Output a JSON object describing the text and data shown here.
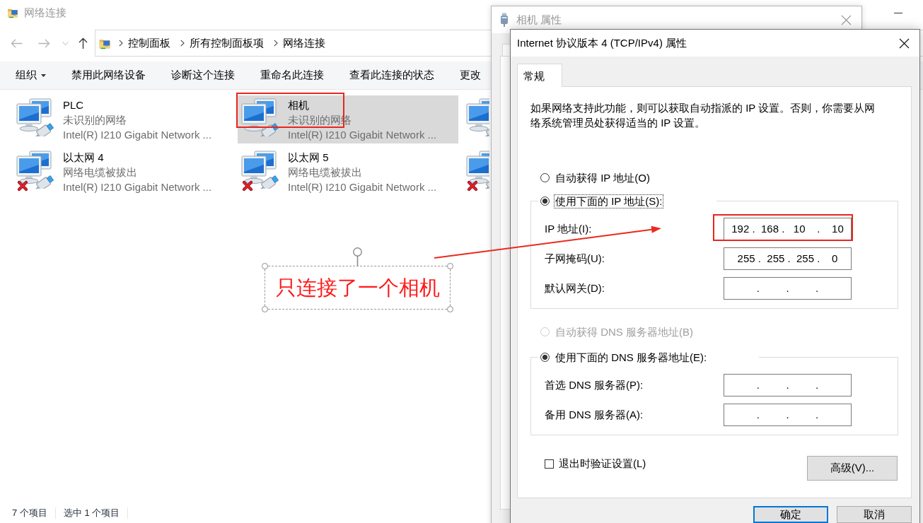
{
  "explorer": {
    "title": "网络连接",
    "breadcrumb": [
      "控制面板",
      "所有控制面板项",
      "网络连接"
    ],
    "commands": [
      {
        "label": "组织",
        "menu": true
      },
      {
        "label": "禁用此网络设备",
        "menu": false
      },
      {
        "label": "诊断这个连接",
        "menu": false
      },
      {
        "label": "重命名此连接",
        "menu": false
      },
      {
        "label": "查看此连接的状态",
        "menu": false
      },
      {
        "label": "更改",
        "menu": false
      }
    ],
    "connections": [
      {
        "name": "PLC",
        "status": "未识别的网络",
        "adapter": "Intel(R) I210 Gigabit Network ...",
        "selected": false,
        "disconnected": false
      },
      {
        "name": "相机",
        "status": "未识别的网络",
        "adapter": "Intel(R) I210 Gigabit Network ...",
        "selected": true,
        "disconnected": false
      },
      {
        "selected": false,
        "disconnected": false
      },
      {
        "name": "以太网 4",
        "status": "网络电缆被拔出",
        "adapter": "Intel(R) I210 Gigabit Network ...",
        "selected": false,
        "disconnected": true
      },
      {
        "name": "以太网 5",
        "status": "网络电缆被拔出",
        "adapter": "Intel(R) I210 Gigabit Network ...",
        "selected": false,
        "disconnected": true
      },
      {
        "selected": false,
        "disconnected": true
      }
    ],
    "status_bar": [
      "7 个项目",
      "选中 1 个项目"
    ]
  },
  "properties_dialog": {
    "title": "相机 属性"
  },
  "ipv4_dialog": {
    "title": "Internet 协议版本 4 (TCP/IPv4) 属性",
    "tabs": [
      {
        "label": "常规",
        "selected": true
      }
    ],
    "description": "如果网络支持此功能，则可以获取自动指派的 IP 设置。否则，你需要从网络系统管理员处获得适当的 IP 设置。",
    "ip": {
      "options": [
        {
          "label": "自动获得 IP 地址(O)",
          "selected": false,
          "disabled": false,
          "focused": false
        },
        {
          "label": "使用下面的 IP 地址(S):",
          "selected": true,
          "disabled": false,
          "focused": true
        }
      ],
      "fields": [
        {
          "label": "IP 地址(I):",
          "value": "192 .  168 .   10    .    10"
        },
        {
          "label": "子网掩码(U):",
          "value": "255 .  255 .  255 .    0"
        },
        {
          "label": "默认网关(D):",
          "value": ".         .         ."
        }
      ]
    },
    "dns": {
      "options": [
        {
          "label": "自动获得 DNS 服务器地址(B)",
          "selected": false,
          "disabled": true,
          "focused": false
        },
        {
          "label": "使用下面的 DNS 服务器地址(E):",
          "selected": true,
          "disabled": false,
          "focused": false
        }
      ],
      "fields": [
        {
          "label": "首选 DNS 服务器(P):",
          "value": ".         .         ."
        },
        {
          "label": "备用 DNS 服务器(A):",
          "value": ".         .         ."
        }
      ]
    },
    "validate_on_exit": {
      "label": "退出时验证设置(L)",
      "checked": false
    },
    "advanced_button": "高级(V)...",
    "buttons": [
      {
        "label": "确定",
        "default": true
      },
      {
        "label": "取消",
        "default": false
      }
    ]
  },
  "annotation": {
    "note": "只连接了一个相机"
  }
}
